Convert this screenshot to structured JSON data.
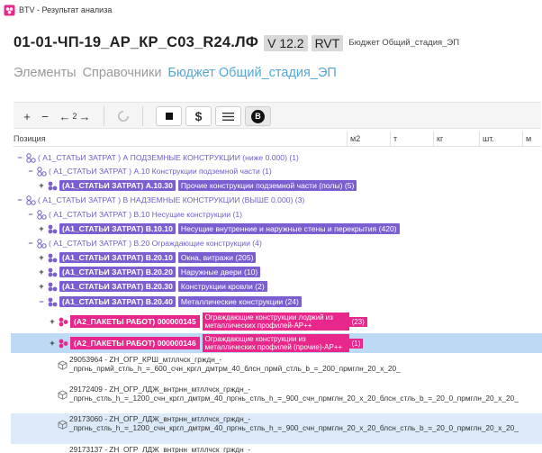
{
  "window": {
    "title": "BTV - Результат анализа"
  },
  "header": {
    "title": "01-01-ЧП-19_АР_КР_С03_R24.ЛФ",
    "version": "V 12.2",
    "format": "RVT",
    "budget": "Бюджет Общий_стадия_ЭП"
  },
  "tabs": [
    {
      "label": "Элементы",
      "active": false
    },
    {
      "label": "Справочники",
      "active": false
    },
    {
      "label": "Бюджет Общий_стадия_ЭП",
      "active": true
    }
  ],
  "toolbar": {
    "plus": "+",
    "minus": "−",
    "back": "←",
    "zoom": "2",
    "forward": "→",
    "dollar": "$",
    "b": "B"
  },
  "columns": {
    "position": "Позиция",
    "m2": "м2",
    "t": "т",
    "kg": "кг",
    "sht": "шт.",
    "m": "м"
  },
  "tree": [
    {
      "code": "( А1_СТАТЬИ ЗАТРАТ ) А",
      "label": "ПОДЗЕМНЫЕ КОНСТРУКЦИИ (ниже 0.000)",
      "count": "(1)"
    },
    {
      "code": "( А1_СТАТЬИ ЗАТРАТ ) А.10",
      "label": "Конструкции подземной части",
      "count": "(1)"
    },
    {
      "code": "(А1_СТАТЬИ ЗАТРАТ) А.10.30",
      "label": "Прочие конструкции подземной части (полы)",
      "count": "(5)"
    },
    {
      "code": "( А1_СТАТЬИ ЗАТРАТ ) В",
      "label": "НАДЗЕМНЫЕ КОНСТРУКЦИИ (ВЫШЕ 0.000)",
      "count": "(3)"
    },
    {
      "code": "( А1_СТАТЬИ ЗАТРАТ ) В.10",
      "label": "Несущие конструкции",
      "count": "(1)"
    },
    {
      "code": "(А1_СТАТЬИ ЗАТРАТ) В.10.10",
      "label": "Несущие внутренние и наружные стены и перекрытия",
      "count": "(420)"
    },
    {
      "code": "( А1_СТАТЬИ ЗАТРАТ ) В.20",
      "label": "Ограждающие конструкции",
      "count": "(4)"
    },
    {
      "code": "(А1_СТАТЬИ ЗАТРАТ) В.20.10",
      "label": "Окна, витражи",
      "count": "(205)"
    },
    {
      "code": "(А1_СТАТЬИ ЗАТРАТ) В.20.20",
      "label": "Наружные двери",
      "count": "(10)"
    },
    {
      "code": "(А1_СТАТЬИ ЗАТРАТ) В.20.30",
      "label": "Конструкции кровли",
      "count": "(2)"
    },
    {
      "code": "(А1_СТАТЬИ ЗАТРАТ) В.20.40",
      "label": "Металлические конструкции",
      "count": "(24)"
    },
    {
      "code": "(А2_ПАКЕТЫ РАБОТ) 000000145",
      "label": "Ограждающие конструкции лоджий из металлических профилей-АР++",
      "count": "(23)"
    },
    {
      "code": "(А2_ПАКЕТЫ РАБОТ) 000000146",
      "label": "Ограждающие конструкции из металлических профилей (прочие)-АР++",
      "count": "(1)"
    }
  ],
  "materials": [
    "29053964 - ZН_ОГР_КРШ_мтллчск_грждн_-_пргнь_прмй_стль_h_=_600_счн_кргл_дмтрм_40_блсн_прмй_стль_b_=_200_прмглн_20_х_20_",
    "29172409 - ZН_ОГР_ЛДЖ_внтрнн_мтллчск_грждн_-_пргнь_стль_h_=_1200_счн_кргл_дмтрм_40_пргнь_стль_h_=_900_счн_прмглн_20_х_20_блсн_стль_b_=_20_0_прмглн_20_х_20_",
    "29173060 - ZН_ОГР_ЛДЖ_внтрнн_мтллчск_грждн_-_пргнь_стль_h_=_1200_счн_кргл_дмтрм_40_пргнь_стль_h_=_900_счн_прмглн_20_х_20_блсн_стль_b_=_20_0_прмглн_20_х_20_",
    "29173137 - ZН_ОГР_ЛДЖ_внтрнн_мтллчск_грждн_-"
  ]
}
